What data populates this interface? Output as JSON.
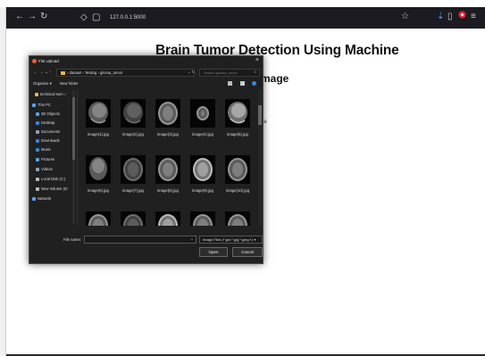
{
  "browser": {
    "url": "127.0.0.1:5000",
    "icons": [
      "back-arrow-icon",
      "forward-arrow-icon",
      "reload-icon",
      "shield-icon",
      "page-info-icon",
      "bookmark-star-icon",
      "download-icon",
      "extensions-icon",
      "profile-icon",
      "menu-icon"
    ]
  },
  "page": {
    "heading": "Brain Tumor Detection Using Machine",
    "subheading": "mage",
    "text1": "t",
    "text2": "ge"
  },
  "dialog": {
    "title": "File Upload",
    "close_glyph": "×",
    "breadcrumb": "› dataset › Testing › glioma_tumor",
    "search_placeholder": "Search glioma_tumor",
    "organize_label": "Organize ▾",
    "new_folder_label": "New folder",
    "sidebar_items": [
      {
        "label": "technical sem ✓",
        "icon": "folder-icon",
        "color": "#e8b84a"
      },
      {
        "label": "This PC",
        "icon": "computer-icon",
        "color": "#5ba3e6"
      },
      {
        "label": "3D Objects",
        "icon": "cube-icon",
        "color": "#5ba3e6"
      },
      {
        "label": "Desktop",
        "icon": "desktop-icon",
        "color": "#3a86d8"
      },
      {
        "label": "Documents",
        "icon": "documents-icon",
        "color": "#8fa3b8"
      },
      {
        "label": "Downloads",
        "icon": "download-icon",
        "color": "#3a86d8"
      },
      {
        "label": "Music",
        "icon": "music-icon",
        "color": "#3a86d8"
      },
      {
        "label": "Pictures",
        "icon": "pictures-icon",
        "color": "#5ba3e6"
      },
      {
        "label": "Videos",
        "icon": "video-icon",
        "color": "#8fa3b8"
      },
      {
        "label": "Local Disk (C:)",
        "icon": "disk-icon",
        "color": "#bbbbbb"
      },
      {
        "label": "New Volume (D:",
        "icon": "disk-icon",
        "color": "#bbbbbb"
      },
      {
        "label": "Network",
        "icon": "network-icon",
        "color": "#5ba3e6"
      }
    ],
    "files": [
      {
        "name": "image(1).jpg",
        "kind": "sagittal"
      },
      {
        "name": "image(2).jpg",
        "kind": "sagittal-dark"
      },
      {
        "name": "image(3).jpg",
        "kind": "axial"
      },
      {
        "name": "image(4).jpg",
        "kind": "axial-small"
      },
      {
        "name": "image(5).jpg",
        "kind": "sagittal-bright"
      },
      {
        "name": "image(6).jpg",
        "kind": "coronal"
      },
      {
        "name": "image(7).jpg",
        "kind": "axial-dark"
      },
      {
        "name": "image(8).jpg",
        "kind": "axial"
      },
      {
        "name": "image(9).jpg",
        "kind": "axial-bright"
      },
      {
        "name": "image(10).jpg",
        "kind": "axial"
      },
      {
        "name": "",
        "kind": "axial"
      },
      {
        "name": "",
        "kind": "axial-dark"
      },
      {
        "name": "",
        "kind": "axial-bright"
      },
      {
        "name": "",
        "kind": "axial"
      },
      {
        "name": "",
        "kind": "axial"
      }
    ],
    "filename_label": "File name:",
    "filename_value": "",
    "filetype": "Image Files (*.jpe;*.jpg;*.jpeg;*.j ▾",
    "open_label": "Open",
    "cancel_label": "Cancel"
  }
}
